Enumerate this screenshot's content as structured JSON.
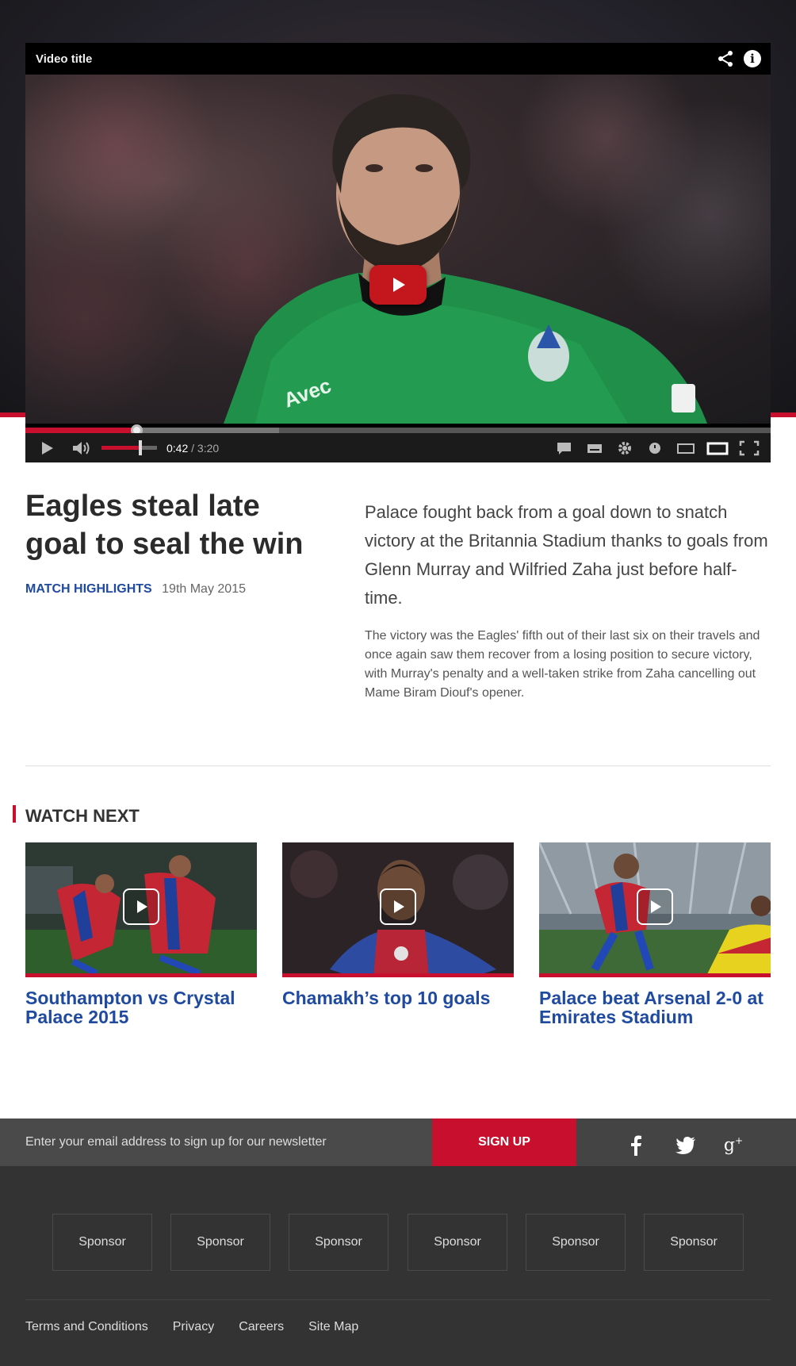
{
  "player": {
    "title": "Video title",
    "current_time": "0:42",
    "separator": " / ",
    "duration": "3:20",
    "progress_fraction": 0.15,
    "buffered_fraction": 0.34,
    "volume_fraction": 0.7,
    "icons": [
      "share-icon",
      "info-icon",
      "play-icon",
      "volume-icon",
      "comments-icon",
      "captions-icon",
      "settings-icon",
      "watch-later-icon",
      "small-player-icon",
      "large-player-icon",
      "fullscreen-icon"
    ]
  },
  "article": {
    "headline": "Eagles steal late goal to seal the win",
    "category": "MATCH HIGHLIGHTS",
    "date": "19th May 2015",
    "lead": "Palace fought back from a goal down to snatch victory at the Britannia Stadium thanks to goals from Glenn Murray and Wilfried Zaha just before half-time.",
    "body": "The victory was the Eagles' fifth out of their last six on their travels and once again saw them recover from a losing position to secure victory, with Murray's penalty and a well-taken strike from Zaha cancelling out Mame Biram Diouf's opener."
  },
  "watch_next": {
    "title": "WATCH NEXT",
    "items": [
      {
        "title": "Southampton vs Crystal Palace 2015"
      },
      {
        "title": "Chamakh’s top 10 goals"
      },
      {
        "title": "Palace beat Arsenal 2-0 at Emirates Stadium"
      }
    ]
  },
  "newsletter": {
    "placeholder": "Enter your email address to sign up for our newsletter",
    "button": "SIGN UP"
  },
  "social": [
    "facebook-icon",
    "twitter-icon",
    "google-plus-icon"
  ],
  "sponsors": [
    "Sponsor",
    "Sponsor",
    "Sponsor",
    "Sponsor",
    "Sponsor",
    "Sponsor"
  ],
  "footer_links": [
    "Terms and Conditions",
    "Privacy",
    "Careers",
    "Site Map"
  ],
  "colors": {
    "accent": "#c8102e",
    "link": "#1f4aa0",
    "footer": "#333333"
  }
}
